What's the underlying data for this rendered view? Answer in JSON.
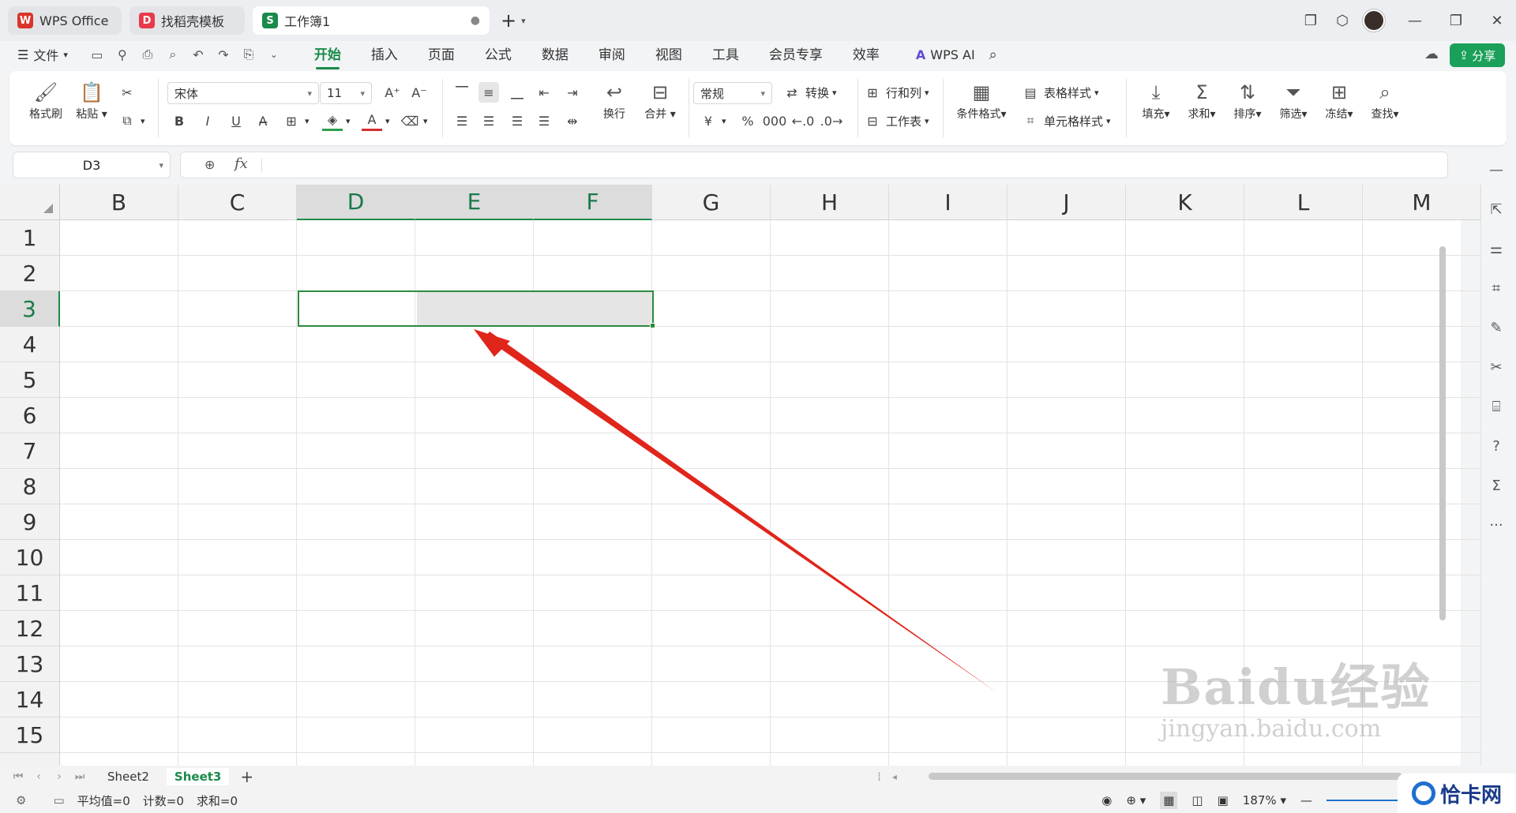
{
  "titlebar": {
    "tabs": [
      {
        "label": "WPS Office",
        "logo": "W",
        "color": "#d9352a"
      },
      {
        "label": "找稻壳模板",
        "logo": "D",
        "color": "#e83a4a"
      },
      {
        "label": "工作簿1",
        "logo": "S",
        "color": "#1a8a4a",
        "active": true
      }
    ],
    "new_tab": "+"
  },
  "menubar": {
    "file": "文件",
    "menus": [
      "开始",
      "插入",
      "页面",
      "公式",
      "数据",
      "审阅",
      "视图",
      "工具",
      "会员专享",
      "效率"
    ],
    "active_menu": "开始",
    "wps_ai": "WPS AI",
    "share": "分享"
  },
  "ribbon": {
    "format_painter": "格式刷",
    "paste": "粘贴",
    "font_name": "宋体",
    "font_size": "11",
    "wrap": "换行",
    "merge": "合并",
    "number_format": "常规",
    "convert": "转换",
    "rows_cols": "行和列",
    "worksheet": "工作表",
    "cond_format": "条件格式",
    "table_style": "表格样式",
    "cell_style": "单元格样式",
    "fill": "填充",
    "sum": "求和",
    "sort": "排序",
    "filter": "筛选",
    "freeze": "冻结",
    "find": "查找",
    "bold": "B",
    "italic": "I",
    "underline": "U",
    "currency": "¥",
    "percent": "%",
    "thousands": "000",
    "font_color_accent": "#d32f2f",
    "fill_color_accent": "#2e9e4e"
  },
  "formula_bar": {
    "cell_ref": "D3",
    "fx": "fx",
    "value": ""
  },
  "grid": {
    "columns": [
      "B",
      "C",
      "D",
      "E",
      "F",
      "G",
      "H",
      "I",
      "J",
      "K",
      "L",
      "M"
    ],
    "selected_columns": [
      "D",
      "E",
      "F"
    ],
    "rows": [
      "1",
      "2",
      "3",
      "4",
      "5",
      "6",
      "7",
      "8",
      "9",
      "10",
      "11",
      "12",
      "13",
      "14",
      "15"
    ],
    "selected_row": "3",
    "selection": "D3:F3",
    "accent": "#2e8b3e"
  },
  "sheets": {
    "tabs": [
      "Sheet2",
      "Sheet3"
    ],
    "active": "Sheet3",
    "add": "+"
  },
  "status": {
    "average": "平均值=0",
    "count": "计数=0",
    "sum": "求和=0",
    "zoom": "187%"
  },
  "watermark": {
    "brand": "Baidu经验",
    "url": "jingyan.baidu.com"
  },
  "badge": {
    "label": "恰卡网"
  }
}
